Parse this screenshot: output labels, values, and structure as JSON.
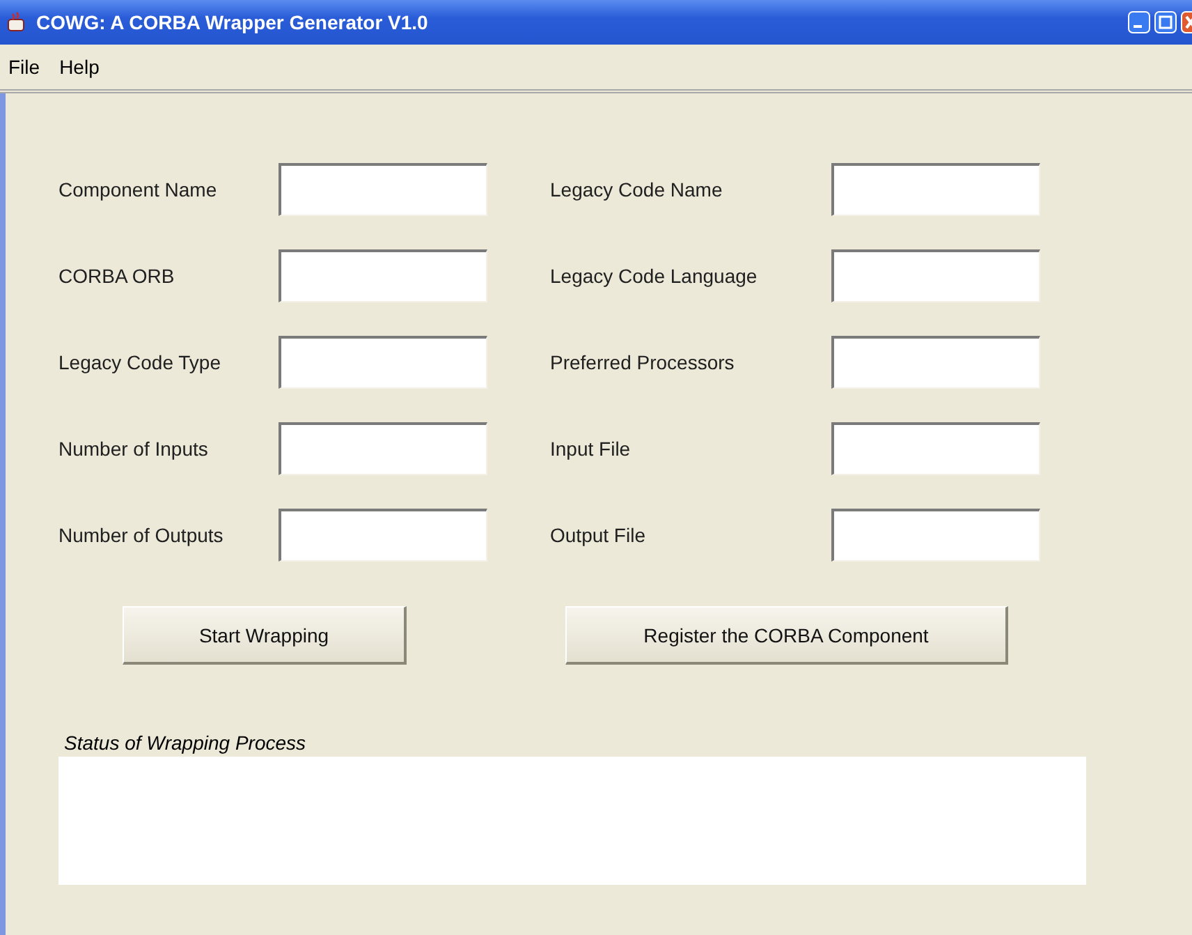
{
  "window": {
    "title": "COWG: A CORBA Wrapper Generator  V1.0"
  },
  "menu": [
    "File",
    "Help"
  ],
  "fields_left": [
    {
      "label": "Component Name"
    },
    {
      "label": "CORBA ORB"
    },
    {
      "label": "Legacy Code Type"
    },
    {
      "label": "Number of Inputs"
    },
    {
      "label": "Number of Outputs"
    }
  ],
  "fields_right": [
    {
      "label": "Legacy Code Name"
    },
    {
      "label": "Legacy Code Language"
    },
    {
      "label": "Preferred Processors"
    },
    {
      "label": "Input File"
    },
    {
      "label": "Output File"
    }
  ],
  "buttons": [
    "Start Wrapping",
    "Register the CORBA Component"
  ],
  "status": {
    "label": "Status of Wrapping Process"
  }
}
